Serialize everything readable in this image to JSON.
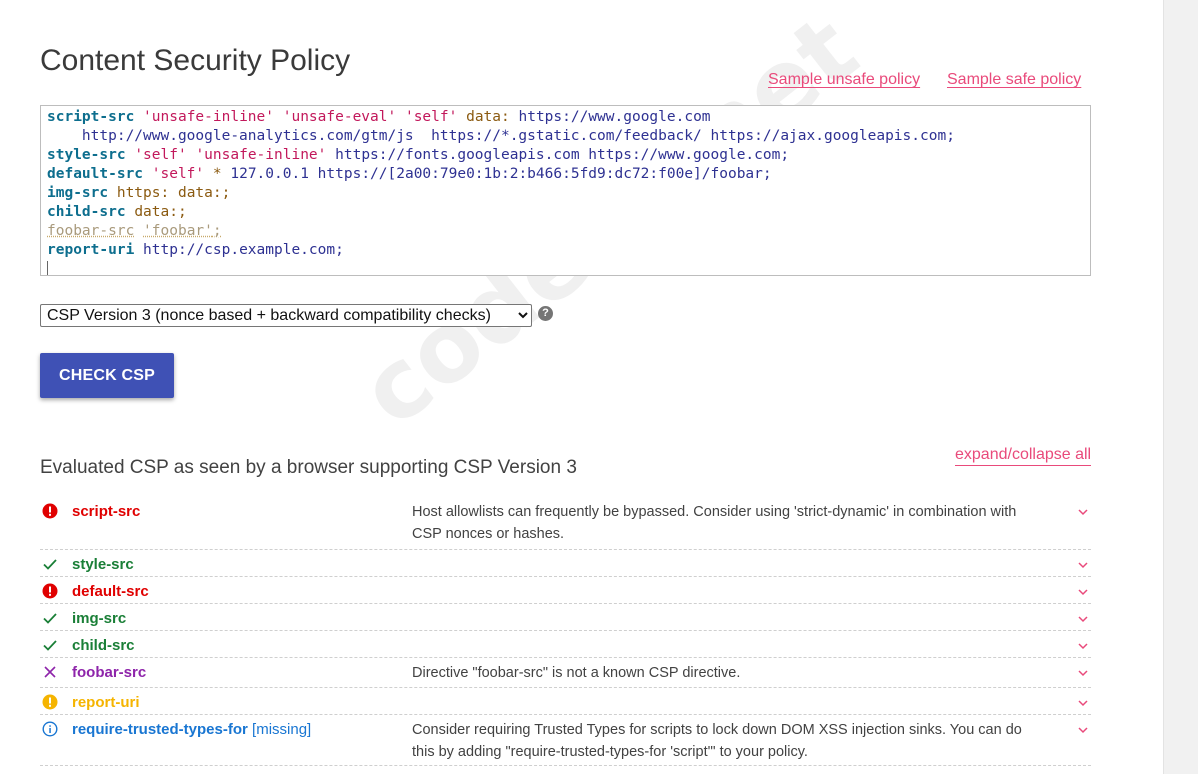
{
  "page": {
    "title": "Content Security Policy",
    "sample_unsafe_label": "Sample unsafe policy",
    "sample_safe_label": "Sample safe policy",
    "watermark": "codeby.net"
  },
  "policy_editor": {
    "lines": [
      [
        [
          "kw",
          "script-src"
        ],
        [
          "plain",
          " "
        ],
        [
          "str",
          "'unsafe-inline'"
        ],
        [
          "plain",
          " "
        ],
        [
          "str",
          "'unsafe-eval'"
        ],
        [
          "plain",
          " "
        ],
        [
          "str",
          "'self'"
        ],
        [
          "plain",
          " "
        ],
        [
          "misc",
          "data:"
        ],
        [
          "plain",
          " "
        ],
        [
          "url",
          "https://www.google.com"
        ]
      ],
      [
        [
          "plain",
          "    "
        ],
        [
          "url",
          "http://www.google-analytics.com/gtm/js"
        ],
        [
          "plain",
          "  "
        ],
        [
          "url",
          "https://*.gstatic.com/feedback/"
        ],
        [
          "plain",
          " "
        ],
        [
          "url",
          "https://ajax.googleapis.com"
        ],
        [
          "url",
          ";"
        ]
      ],
      [
        [
          "kw",
          "style-src"
        ],
        [
          "plain",
          " "
        ],
        [
          "str",
          "'self'"
        ],
        [
          "plain",
          " "
        ],
        [
          "str",
          "'unsafe-inline'"
        ],
        [
          "plain",
          " "
        ],
        [
          "url",
          "https://fonts.googleapis.com"
        ],
        [
          "plain",
          " "
        ],
        [
          "url",
          "https://www.google.com"
        ],
        [
          "url",
          ";"
        ]
      ],
      [
        [
          "kw",
          "default-src"
        ],
        [
          "plain",
          " "
        ],
        [
          "str",
          "'self'"
        ],
        [
          "plain",
          " "
        ],
        [
          "misc",
          "*"
        ],
        [
          "plain",
          " "
        ],
        [
          "url",
          "127.0.0.1"
        ],
        [
          "plain",
          " "
        ],
        [
          "url",
          "https://[2a00:79e0:1b:2:b466:5fd9:dc72:f00e]/foobar"
        ],
        [
          "url",
          ";"
        ]
      ],
      [
        [
          "kw",
          "img-src"
        ],
        [
          "plain",
          " "
        ],
        [
          "misc",
          "https:"
        ],
        [
          "plain",
          " "
        ],
        [
          "misc",
          "data:"
        ],
        [
          "misc",
          ";"
        ]
      ],
      [
        [
          "kw",
          "child-src"
        ],
        [
          "plain",
          " "
        ],
        [
          "misc",
          "data:"
        ],
        [
          "misc",
          ";"
        ]
      ],
      [
        [
          "unknown",
          "foobar-src"
        ],
        [
          "plain",
          " "
        ],
        [
          "unknown",
          "'foobar'"
        ],
        [
          "unknown",
          ";"
        ]
      ],
      [
        [
          "kw",
          "report-uri"
        ],
        [
          "plain",
          " "
        ],
        [
          "url",
          "http://csp.example.com"
        ],
        [
          "url",
          ";"
        ]
      ]
    ]
  },
  "version_select": {
    "selected": "CSP Version 3 (nonce based + backward compatibility checks)",
    "help_glyph": "?"
  },
  "check_button": {
    "label": "CHECK CSP"
  },
  "evaluation": {
    "title": "Evaluated CSP as seen by a browser supporting CSP Version 3",
    "expand_label": "expand/collapse all",
    "colors": {
      "high": "#e00000",
      "ok": "#1a7f37",
      "invalid": "#8e24aa",
      "medium": "#f5b400",
      "info": "#1976d2",
      "chevron": "#e94a7b"
    },
    "rows": [
      {
        "directive": "script-src",
        "severity": "high",
        "icon": "error-circle-icon",
        "description": "Host allowlists can frequently be bypassed. Consider using 'strict-dynamic' in combination with CSP nonces or hashes."
      },
      {
        "directive": "style-src",
        "severity": "ok",
        "icon": "check-icon",
        "description": ""
      },
      {
        "directive": "default-src",
        "severity": "high",
        "icon": "error-circle-icon",
        "description": ""
      },
      {
        "directive": "img-src",
        "severity": "ok",
        "icon": "check-icon",
        "description": ""
      },
      {
        "directive": "child-src",
        "severity": "ok",
        "icon": "check-icon",
        "description": ""
      },
      {
        "directive": "foobar-src",
        "severity": "invalid",
        "icon": "cross-icon",
        "description": "Directive \"foobar-src\" is not a known CSP directive."
      },
      {
        "directive": "report-uri",
        "severity": "medium",
        "icon": "warning-circle-icon",
        "description": ""
      },
      {
        "directive": "require-trusted-types-for",
        "suffix": "[missing]",
        "severity": "info",
        "icon": "info-circle-icon",
        "description": "Consider requiring Trusted Types for scripts to lock down DOM XSS injection sinks. You can do this by adding \"require-trusted-types-for 'script'\" to your policy."
      }
    ]
  }
}
